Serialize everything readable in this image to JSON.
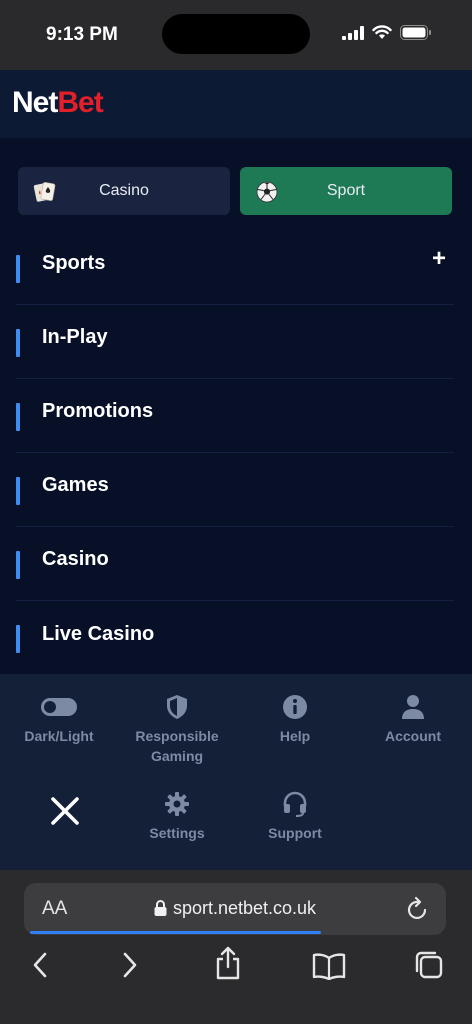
{
  "status_bar": {
    "time": "9:13 PM"
  },
  "header": {
    "logo_net": "Net",
    "logo_bet": "Bet"
  },
  "switch": {
    "casino_label": "Casino",
    "sport_label": "Sport",
    "active": "Sport"
  },
  "menu": {
    "items": [
      {
        "label": "Sports",
        "expandable": true,
        "expand_symbol": "+"
      },
      {
        "label": "In-Play"
      },
      {
        "label": "Promotions"
      },
      {
        "label": "Games"
      },
      {
        "label": "Casino"
      },
      {
        "label": "Live Casino"
      }
    ]
  },
  "bottom_panel": {
    "dark_light": "Dark/Light",
    "responsible_gaming": "Responsible Gaming",
    "help": "Help",
    "account": "Account",
    "settings": "Settings",
    "support": "Support"
  },
  "browser": {
    "text_size_label": "AA",
    "url": "sport.netbet.co.uk",
    "load_progress_fraction": 0.69
  },
  "colors": {
    "brand_red": "#e2202a",
    "sport_green": "#1e7a55",
    "accent_blue": "#3d8ef0",
    "menu_bg": "#071027"
  }
}
